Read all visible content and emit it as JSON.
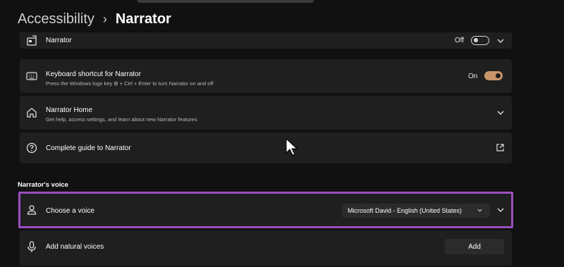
{
  "header": {
    "parent": "Accessibility",
    "separator": "›",
    "current": "Narrator"
  },
  "rows": {
    "narrator": {
      "title": "Narrator",
      "status": "Off",
      "icon": "narrator-icon"
    },
    "shortcut": {
      "title": "Keyboard shortcut for Narrator",
      "subtitle": "Press the Windows logo key ⊞ + Ctrl + Enter to turn Narrator on and off",
      "status": "On",
      "icon": "keyboard-icon"
    },
    "home": {
      "title": "Narrator Home",
      "subtitle": "Get help, access settings, and learn about new Narrator features",
      "icon": "home-icon"
    },
    "guide": {
      "title": "Complete guide to Narrator",
      "icon": "help-icon"
    }
  },
  "voice_section": {
    "title": "Narrator's voice",
    "choose": {
      "title": "Choose a voice",
      "selected": "Microsoft David - English (United States)"
    },
    "natural": {
      "title": "Add natural voices",
      "button": "Add"
    }
  },
  "colors": {
    "background": "#111111",
    "card": "#1f1f1f",
    "accent_toggle": "#c8956a",
    "highlight": "#9a4fc0"
  }
}
